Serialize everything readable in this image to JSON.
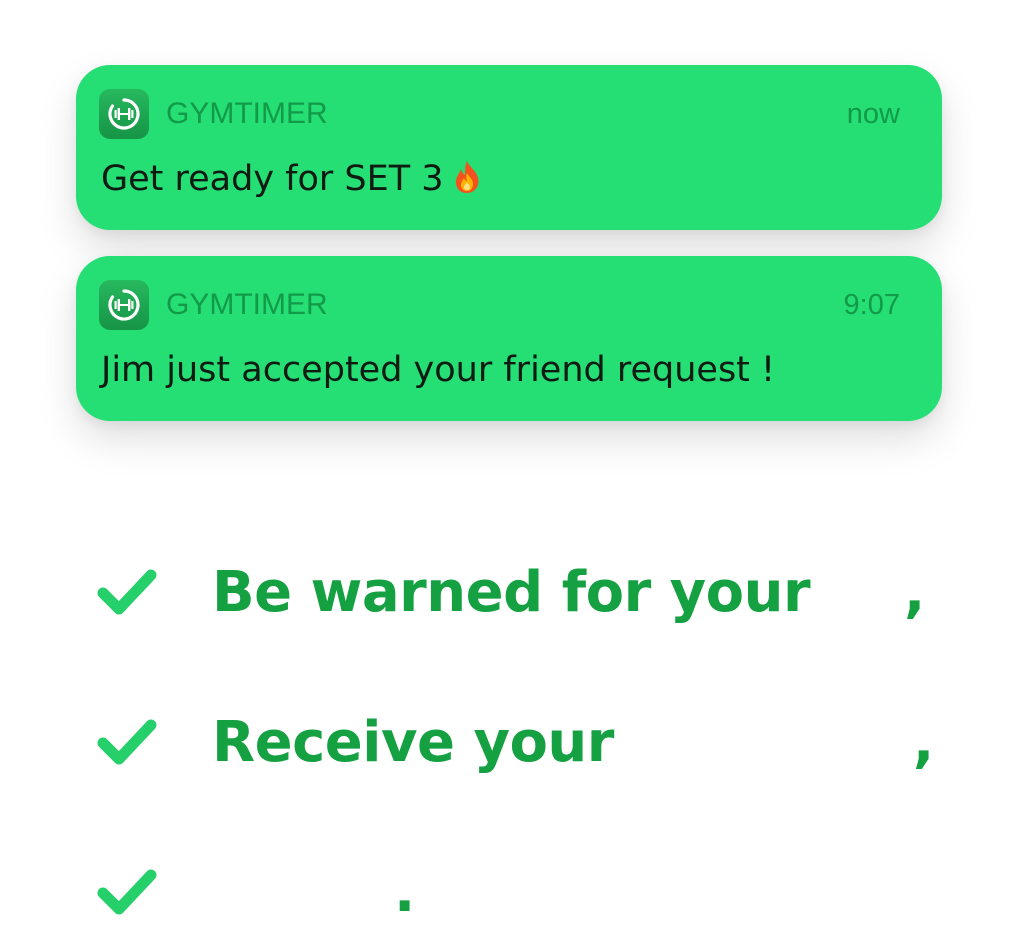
{
  "notifications": [
    {
      "app_name": "GYMTIMER",
      "time": "now",
      "message": "Get ready for SET 3",
      "emoji": "fire-emoji-icon"
    },
    {
      "app_name": "GYMTIMER",
      "time": "9:07",
      "message": "Jim just accepted your friend request !"
    }
  ],
  "features": [
    {
      "text": "Be warned for your",
      "punctuation": ","
    },
    {
      "text": "Receive your",
      "punctuation": ","
    },
    {
      "text": "",
      "punctuation": "."
    }
  ],
  "colors": {
    "notification_bg": "#25de74",
    "app_name": "#139a48",
    "feature_text": "#15a142",
    "check": "#25cf6a"
  }
}
